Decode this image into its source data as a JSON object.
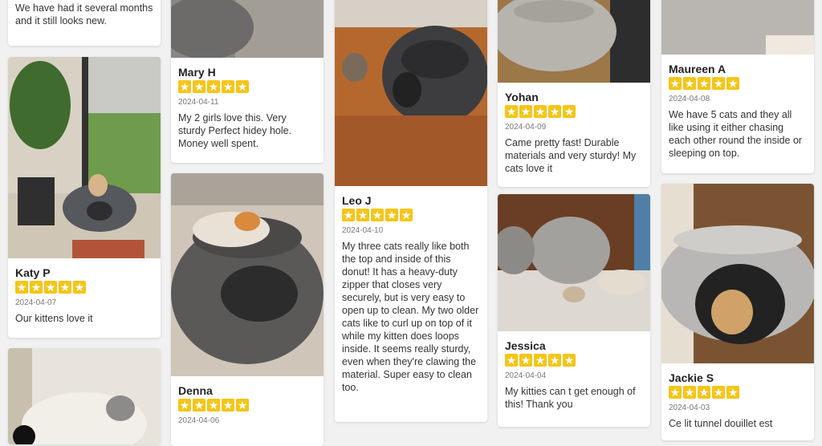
{
  "reviews": {
    "col1_top": {
      "text": "We have had it several months and it still looks new."
    },
    "katy": {
      "name": "Katy P",
      "date": "2024-04-07",
      "text": "Our kittens love it"
    },
    "mary": {
      "name": "Mary H",
      "date": "2024-04-11",
      "text": "My 2 girls love this. Very sturdy Perfect hidey hole. Money well spent."
    },
    "denna": {
      "name": "Denna",
      "date": "2024-04-06",
      "text": ""
    },
    "leo": {
      "name": "Leo J",
      "date": "2024-04-10",
      "text": "My three cats really like both the top and inside of this donut! It has a heavy-duty zipper that closes very securely, but is very easy to open up to clean. My two older cats like to curl up on top of it while my kitten does loops inside. It seems really sturdy, even when they're clawing the material. Super easy to clean too."
    },
    "yohan": {
      "name": "Yohan",
      "date": "2024-04-09",
      "text": "Came pretty fast! Durable materials and very sturdy! My cats love it"
    },
    "jessica": {
      "name": "Jessica",
      "date": "2024-04-04",
      "text": "My kitties can t get enough of this! Thank you"
    },
    "maureen": {
      "name": "Maureen A",
      "date": "2024-04-08",
      "text": "We have 5 cats and they all like using it either chasing each other round the inside or sleeping on top."
    },
    "jackie": {
      "name": "Jackie S",
      "date": "2024-04-03",
      "text": "Ce lit tunnel douillet est"
    }
  },
  "colors": {
    "star": "#f5c518",
    "card": "#ffffff",
    "background": "#f1f1f1"
  },
  "icons": [
    "star-icon"
  ]
}
